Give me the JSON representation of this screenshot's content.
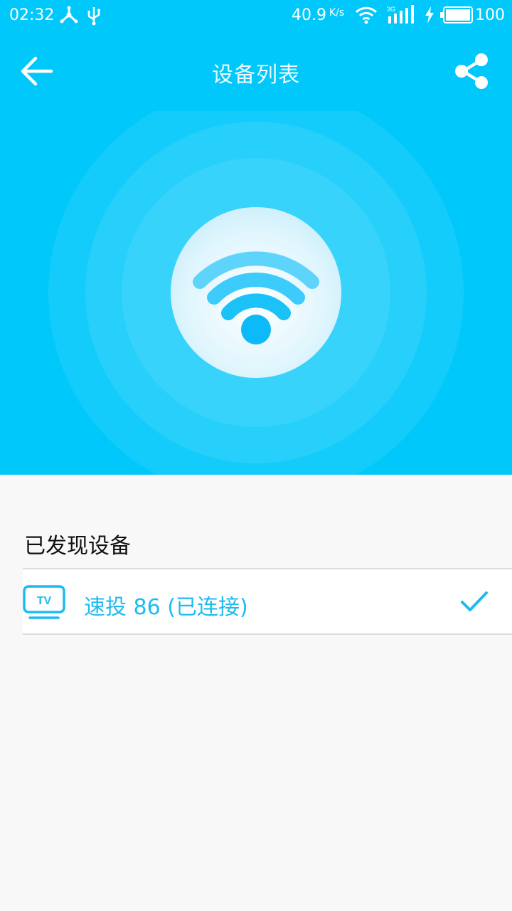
{
  "status_bar": {
    "time": "02:32",
    "net_speed": "40.9",
    "net_speed_unit": "K/s",
    "network_type": "3G",
    "battery": "100",
    "icons": [
      "share-nodes-icon",
      "usb-icon",
      "wifi-icon",
      "signal-icon",
      "charging-icon",
      "battery-icon"
    ]
  },
  "app_bar": {
    "title": "设备列表",
    "back_icon": "arrow-left-icon",
    "share_icon": "share-icon"
  },
  "radar": {
    "icon": "wifi-icon"
  },
  "devices_section": {
    "title": "已发现设备",
    "devices": [
      {
        "icon_text": "TV",
        "label": "速投 86 (已连接)",
        "connected": true
      }
    ]
  },
  "colors": {
    "primary": "#00c8fb",
    "accent": "#1cbcf0",
    "background": "#f8f8f8"
  }
}
